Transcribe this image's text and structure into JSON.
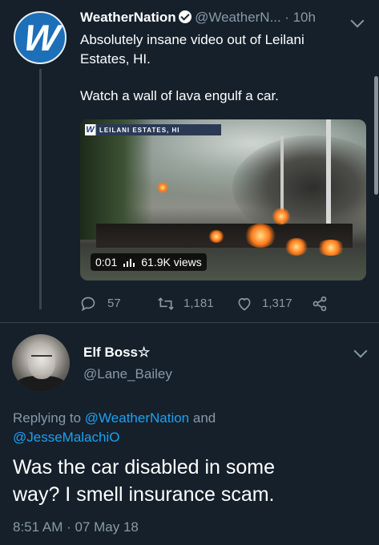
{
  "tweet": {
    "name": "WeatherNation",
    "handle": "@WeatherN...",
    "time": "· 10h",
    "text_line1": "Absolutely insane video out of Leilani",
    "text_line2": "Estates, HI.",
    "text_line3": "Watch a wall of lava engulf a car.",
    "video": {
      "badge_text": "LEILANI ESTATES, HI",
      "badge_logo": "W",
      "duration": "0:01",
      "views": "61.9K views"
    },
    "actions": {
      "replies": "57",
      "retweets": "1,181",
      "likes": "1,317"
    }
  },
  "reply": {
    "name": "Elf Boss",
    "star": "☆",
    "handle": "@Lane_Bailey",
    "replying_prefix": "Replying to",
    "replying_user1": "@WeatherNation",
    "replying_and": "and",
    "replying_user2": "@JesseMalachiO",
    "text_line1": "Was the car disabled in some",
    "text_line2": "way? I smell insurance scam.",
    "timestamp": "8:51 AM · 07 May 18"
  },
  "icons": [
    "verified-icon",
    "chevron-down-icon",
    "reply-icon",
    "retweet-icon",
    "like-icon",
    "share-icon",
    "signal-bars-icon"
  ]
}
